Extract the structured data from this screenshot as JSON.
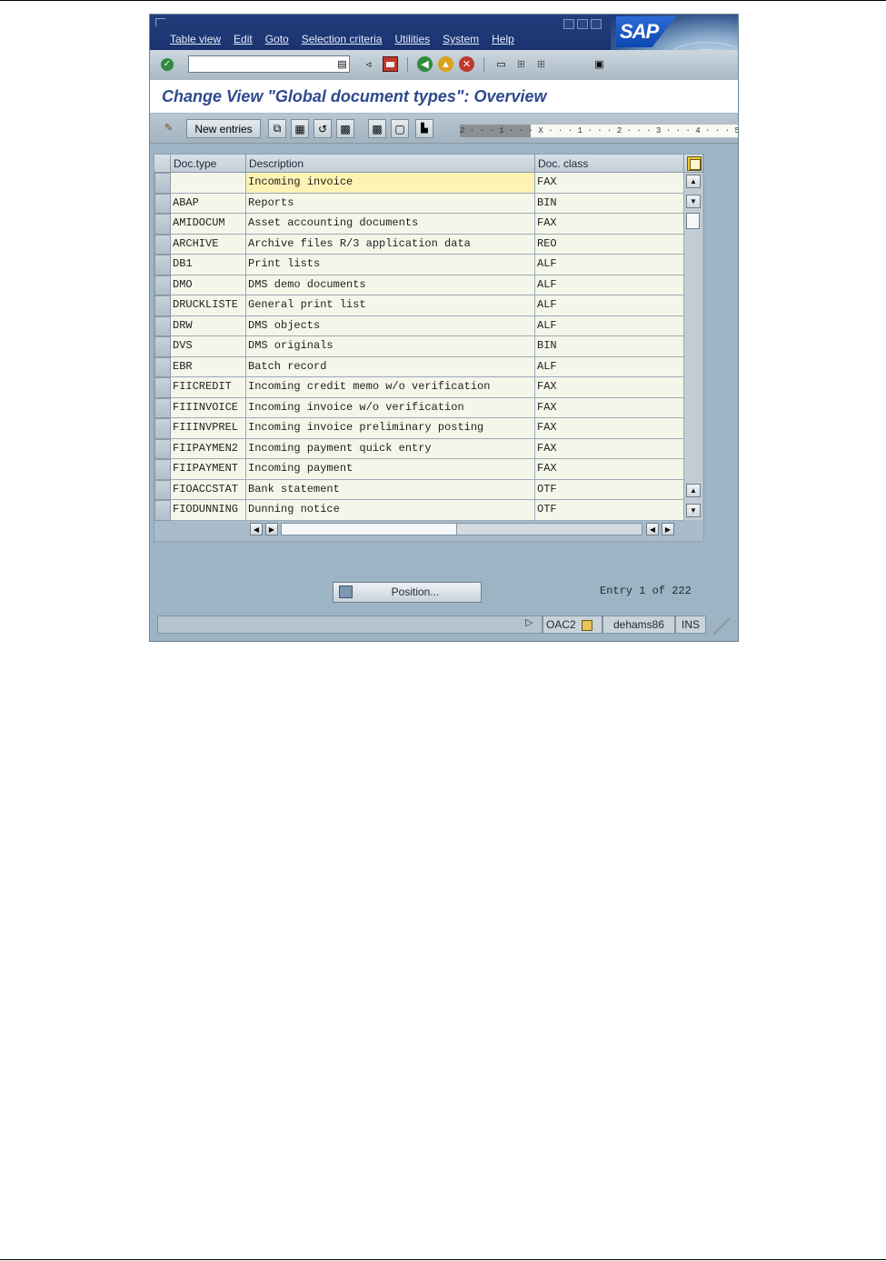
{
  "window": {
    "menu": [
      "Table view",
      "Edit",
      "Goto",
      "Selection criteria",
      "Utilities",
      "System",
      "Help"
    ],
    "brand": "SAP"
  },
  "title": "Change View \"Global document types\": Overview",
  "app_toolbar": {
    "new_entries_label": "New entries",
    "ruler_text": "2 · · · 1 · · · X · · · 1 · · · 2 · · · 3 · · · 4 · · · 5 · · ·"
  },
  "table": {
    "headers": [
      "Doc.type",
      "Description",
      "Doc. class"
    ],
    "rows": [
      {
        "doc_type": "",
        "description": "Incoming invoice",
        "doc_class": "FAX"
      },
      {
        "doc_type": "ABAP",
        "description": "Reports",
        "doc_class": "BIN"
      },
      {
        "doc_type": "AMIDOCUM",
        "description": "Asset accounting documents",
        "doc_class": "FAX"
      },
      {
        "doc_type": "ARCHIVE",
        "description": "Archive files R/3 application data",
        "doc_class": "REO"
      },
      {
        "doc_type": "DB1",
        "description": "Print lists",
        "doc_class": "ALF"
      },
      {
        "doc_type": "DMO",
        "description": "DMS demo documents",
        "doc_class": "ALF"
      },
      {
        "doc_type": "DRUCKLISTE",
        "description": "General print list",
        "doc_class": "ALF"
      },
      {
        "doc_type": "DRW",
        "description": "DMS objects",
        "doc_class": "ALF"
      },
      {
        "doc_type": "DVS",
        "description": "DMS originals",
        "doc_class": "BIN"
      },
      {
        "doc_type": "EBR",
        "description": "Batch record",
        "doc_class": "ALF"
      },
      {
        "doc_type": "FIICREDIT",
        "description": "Incoming credit memo w/o verification",
        "doc_class": "FAX"
      },
      {
        "doc_type": "FIIINVOICE",
        "description": "Incoming invoice w/o verification",
        "doc_class": "FAX"
      },
      {
        "doc_type": "FIIINVPREL",
        "description": "Incoming invoice preliminary posting",
        "doc_class": "FAX"
      },
      {
        "doc_type": "FIIPAYMEN2",
        "description": "Incoming payment quick entry",
        "doc_class": "FAX"
      },
      {
        "doc_type": "FIIPAYMENT",
        "description": "Incoming payment",
        "doc_class": "FAX"
      },
      {
        "doc_type": "FIOACCSTAT",
        "description": "Bank statement",
        "doc_class": "OTF"
      },
      {
        "doc_type": "FIODUNNING",
        "description": "Dunning notice",
        "doc_class": "OTF"
      }
    ]
  },
  "position_button_label": "Position...",
  "entry_text": "Entry 1 of 222",
  "status": {
    "transaction": "OAC2",
    "server": "dehams86",
    "mode": "INS"
  },
  "colors": {
    "menubar": "#1a3270",
    "window_bg": "#9cb4c4",
    "title_text": "#2e4a8e",
    "cell_bg": "#f5f6ea",
    "highlight_cell": "#fff3b4"
  }
}
